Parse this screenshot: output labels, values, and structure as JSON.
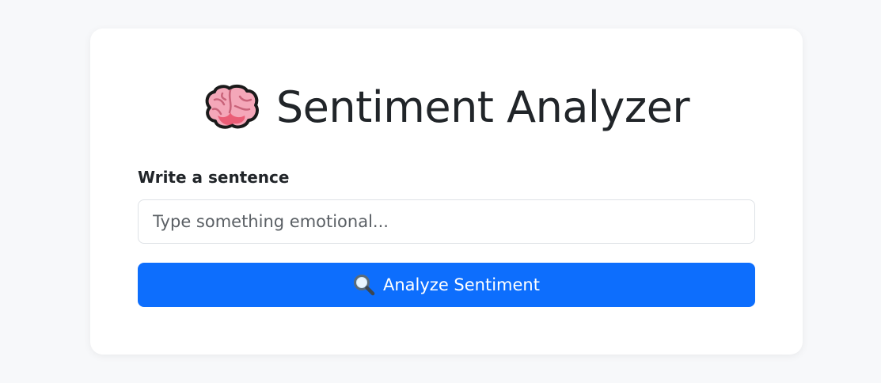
{
  "app": {
    "title": "Sentiment Analyzer",
    "title_icon": "brain-icon"
  },
  "form": {
    "label": "Write a sentence",
    "input_value": "",
    "input_placeholder": "Type something emotional...",
    "button_label": "Analyze Sentiment",
    "button_icon": "search-icon"
  },
  "colors": {
    "page_background": "#f7f8fa",
    "card_background": "#ffffff",
    "primary": "#0d6efd",
    "text": "#212529",
    "input_border": "#dee2e6"
  }
}
